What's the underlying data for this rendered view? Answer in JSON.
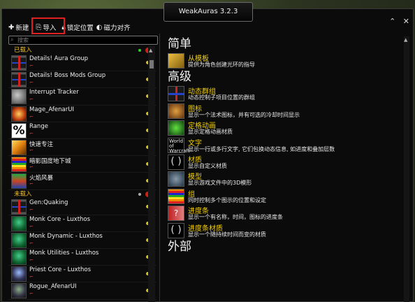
{
  "window": {
    "title": "WeakAuras 3.2.3",
    "minimize_glyph": "⌃",
    "close_glyph": "✕"
  },
  "toolbar": {
    "new_label": "新建",
    "import_label": "导入",
    "lock_label": "锁定位置",
    "snap_label": "磁力对齐"
  },
  "search": {
    "placeholder": "搜索"
  },
  "left": {
    "loaded_header": "已载入",
    "unloaded_header": "未载入",
    "loaded": [
      {
        "name": "Details! Aura Group",
        "sub": "⌐",
        "icon": "ic-group"
      },
      {
        "name": "Details! Boss Mods Group",
        "sub": "⌐",
        "icon": "ic-boss"
      },
      {
        "name": "Interrupt Tracker",
        "sub": "⌐",
        "icon": "ic-interrupt"
      },
      {
        "name": "Mage_AfenarUI",
        "sub": "⌐",
        "icon": "ic-mage"
      },
      {
        "name": "Range",
        "sub": "⌐",
        "icon": "ic-range",
        "glyph": "%"
      },
      {
        "name": "快速专注",
        "sub": "⌐",
        "icon": "ic-haste"
      },
      {
        "name": "暗影国度地下城",
        "sub": "⌐",
        "icon": "ic-dungeon"
      },
      {
        "name": "火焰风暴",
        "sub": "⌐",
        "icon": "ic-fire"
      }
    ],
    "unloaded": [
      {
        "name": "Gen:Quaking",
        "sub": "⌐",
        "icon": "ic-gen"
      },
      {
        "name": "Monk Core - Luxthos",
        "sub": "⌐",
        "icon": "ic-monk"
      },
      {
        "name": "Monk Dynamic - Luxthos",
        "sub": "⌐",
        "icon": "ic-monk"
      },
      {
        "name": "Monk Utilities - Luxthos",
        "sub": "⌐",
        "icon": "ic-monk"
      },
      {
        "name": "Priest Core - Luxthos",
        "sub": "⌐",
        "icon": "ic-priest"
      },
      {
        "name": "Rogue_AfenarUI",
        "sub": "⌐",
        "icon": "ic-rogue"
      }
    ]
  },
  "right": {
    "simple_heading": "简单",
    "advanced_heading": "高级",
    "external_heading": "外部",
    "simple": [
      {
        "title": "从模板",
        "desc": "提供为角色创建光环的指导",
        "icon": "ri-template"
      }
    ],
    "advanced": [
      {
        "title": "动态群组",
        "desc": "动态控制子项目位置的群组",
        "icon": "ri-dgroup"
      },
      {
        "title": "图标",
        "desc": "显示一个法术图标，并有可选的冷却时间显示",
        "icon": "ri-icon"
      },
      {
        "title": "定格动画",
        "desc": "显示定格动画材质",
        "icon": "ri-anim"
      },
      {
        "title": "文字",
        "desc": "显示一行或多行文字, 它们包换动态信息, 如进度和叠加层数",
        "icon": "ri-text",
        "glyph": "World of Warcraft"
      },
      {
        "title": "材质",
        "desc": "显示自定义材质",
        "icon": "ri-texture",
        "glyph": "( )"
      },
      {
        "title": "模型",
        "desc": "显示游戏文件中的3D模形",
        "icon": "ri-model"
      },
      {
        "title": "组",
        "desc": "同时控制多个图示的位置和设定",
        "icon": "ri-group"
      },
      {
        "title": "进度条",
        "desc": "显示一个有名称，时间，图标的进度条",
        "icon": "ri-progress",
        "glyph": "?"
      },
      {
        "title": "进度条材质",
        "desc": "显示一个随持续时间而变的材质",
        "icon": "ri-ptexture",
        "glyph": "( )"
      }
    ]
  }
}
